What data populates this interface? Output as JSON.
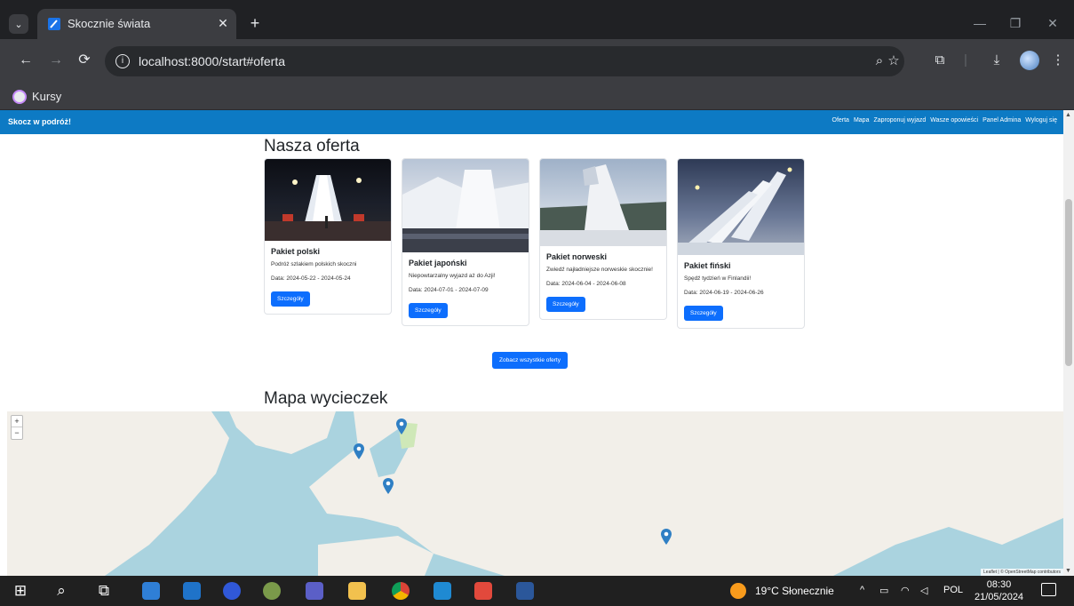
{
  "browser": {
    "tab_title": "Skocznie świata",
    "url": "localhost:8000/start#oferta",
    "bookmark": "Kursy"
  },
  "site": {
    "brand": "Skocz w podróż!",
    "nav": [
      "Oferta",
      "Mapa",
      "Zaproponuj wyjazd",
      "Wasze opowieści",
      "Panel Admina",
      "Wyloguj się"
    ]
  },
  "offer": {
    "title": "Nasza oferta",
    "cards": [
      {
        "title": "Pakiet polski",
        "text": "Podróż szlakiem polskich skoczni",
        "date": "Data: 2024-05-22 - 2024-05-24",
        "button": "Szczegóły"
      },
      {
        "title": "Pakiet japoński",
        "text": "Niepowtarzalny wyjazd aż do Azji!",
        "date": "Data: 2024-07-01 - 2024-07-09",
        "button": "Szczegóły"
      },
      {
        "title": "Pakiet norweski",
        "text": "Zwiedź najładniejsze norweskie skocznie!",
        "date": "Data: 2024-06-04 - 2024-06-08",
        "button": "Szczegóły"
      },
      {
        "title": "Pakiet fiński",
        "text": "Spędź tydzień w Finlandii!",
        "date": "Data: 2024-06-19 - 2024-06-26",
        "button": "Szczegóły"
      }
    ],
    "all_button": "Zobacz wszystkie oferty"
  },
  "map": {
    "title": "Mapa wycieczek",
    "zoom_in": "+",
    "zoom_out": "−",
    "attribution": "Leaflet | © OpenStreetMap contributors"
  },
  "taskbar": {
    "weather": "19°C Słonecznie",
    "lang": "POL",
    "time": "08:30",
    "date": "21/05/2024"
  }
}
